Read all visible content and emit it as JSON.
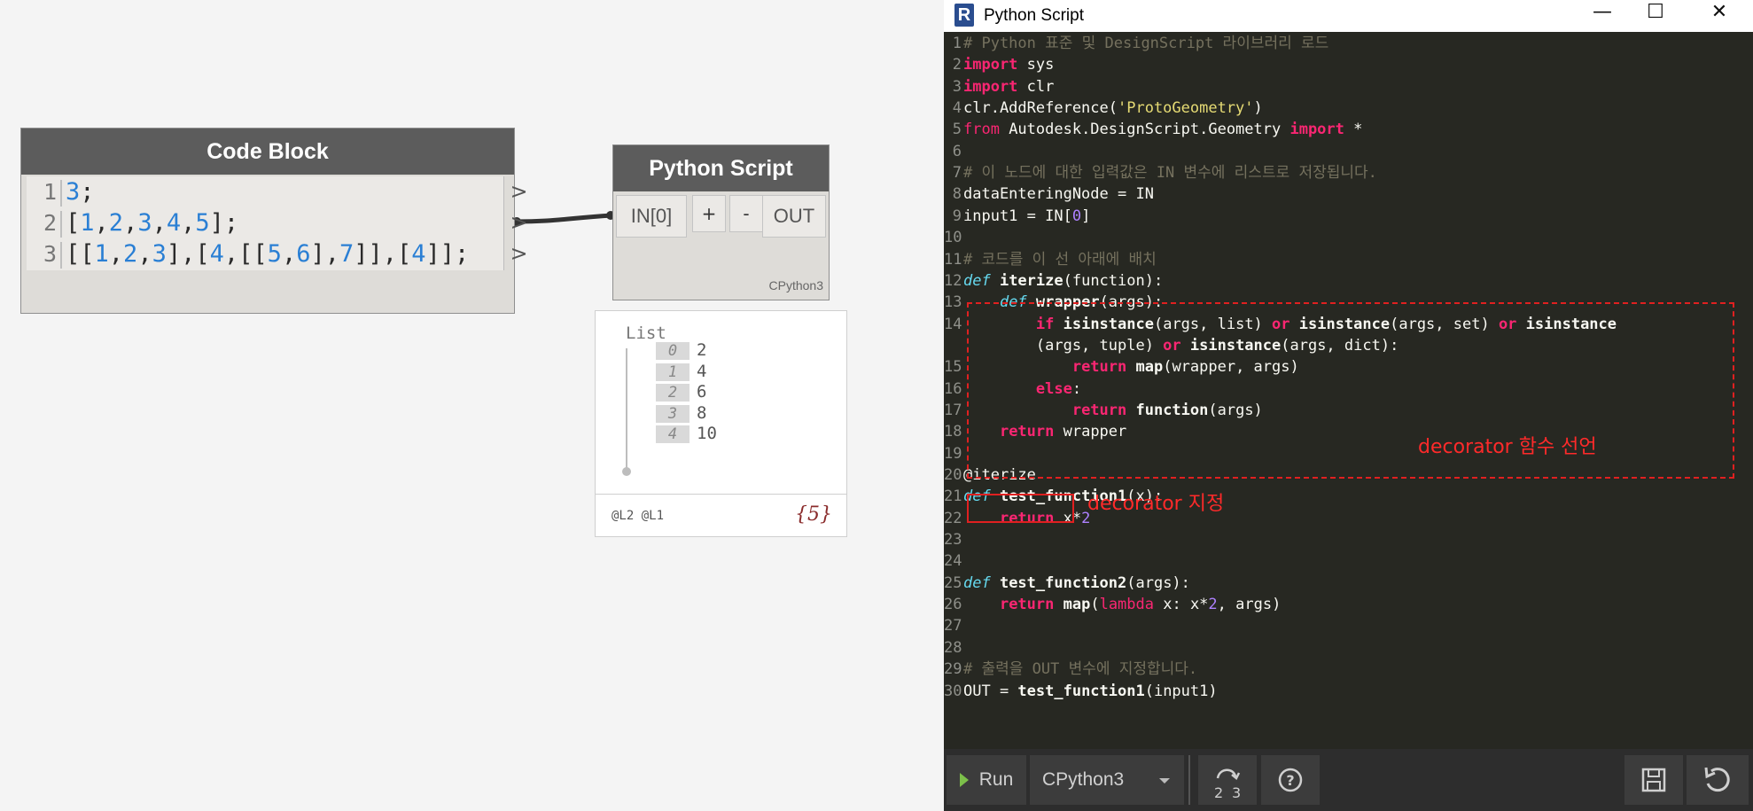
{
  "canvas": {
    "code_block": {
      "title": "Code Block",
      "lines": [
        {
          "num": "1",
          "pre": "",
          "tokens": [
            {
              "t": "3",
              "c": "num"
            },
            {
              "t": ";",
              "c": "text"
            }
          ]
        },
        {
          "num": "2",
          "tokens": [
            {
              "t": "[",
              "c": "text"
            },
            {
              "t": "1",
              "c": "num"
            },
            {
              "t": ",",
              "c": "text"
            },
            {
              "t": "2",
              "c": "num"
            },
            {
              "t": ",",
              "c": "text"
            },
            {
              "t": "3",
              "c": "num"
            },
            {
              "t": ",",
              "c": "text"
            },
            {
              "t": "4",
              "c": "num"
            },
            {
              "t": ",",
              "c": "text"
            },
            {
              "t": "5",
              "c": "num"
            },
            {
              "t": "];",
              "c": "text"
            }
          ]
        },
        {
          "num": "3",
          "tokens": [
            {
              "t": "[[",
              "c": "text"
            },
            {
              "t": "1",
              "c": "num"
            },
            {
              "t": ",",
              "c": "text"
            },
            {
              "t": "2",
              "c": "num"
            },
            {
              "t": ",",
              "c": "text"
            },
            {
              "t": "3",
              "c": "num"
            },
            {
              "t": "],[",
              "c": "text"
            },
            {
              "t": "4",
              "c": "num"
            },
            {
              "t": ",[[",
              "c": "text"
            },
            {
              "t": "5",
              "c": "num"
            },
            {
              "t": ",",
              "c": "text"
            },
            {
              "t": "6",
              "c": "num"
            },
            {
              "t": "],",
              "c": "text"
            },
            {
              "t": "7",
              "c": "num"
            },
            {
              "t": "]],[",
              "c": "text"
            },
            {
              "t": "4",
              "c": "num"
            },
            {
              "t": "]];",
              "c": "text"
            }
          ]
        }
      ],
      "output_ports": [
        ">",
        ">",
        ">"
      ]
    },
    "python_node": {
      "title": "Python Script",
      "input_port": "IN[0]",
      "add_label": "+",
      "remove_label": "-",
      "output_port": "OUT",
      "engine": "CPython3"
    },
    "preview": {
      "title": "List",
      "items": [
        {
          "index": "0",
          "value": "2"
        },
        {
          "index": "1",
          "value": "4"
        },
        {
          "index": "2",
          "value": "6"
        },
        {
          "index": "3",
          "value": "8"
        },
        {
          "index": "4",
          "value": "10"
        }
      ],
      "levels": "@L2 @L1",
      "count": "{5}"
    }
  },
  "editor_window": {
    "app_icon": "R",
    "title": "Python Script",
    "minimize": "—",
    "maximize": "☐",
    "close": "✕",
    "lines": [
      {
        "n": "1",
        "tokens": [
          {
            "t": "# Python 표준 및 DesignScript 라이브러리 로드",
            "c": "cm"
          }
        ]
      },
      {
        "n": "2",
        "tokens": [
          {
            "t": "import",
            "c": "kw bold"
          },
          {
            "t": " sys",
            "c": "txt"
          }
        ]
      },
      {
        "n": "3",
        "tokens": [
          {
            "t": "import",
            "c": "kw bold"
          },
          {
            "t": " clr",
            "c": "txt"
          }
        ]
      },
      {
        "n": "4",
        "tokens": [
          {
            "t": "clr.AddReference(",
            "c": "txt"
          },
          {
            "t": "'ProtoGeometry'",
            "c": "str"
          },
          {
            "t": ")",
            "c": "txt"
          }
        ]
      },
      {
        "n": "5",
        "tokens": [
          {
            "t": "from",
            "c": "kw"
          },
          {
            "t": " Autodesk.DesignScript.Geometry ",
            "c": "txt"
          },
          {
            "t": "import",
            "c": "kw bold"
          },
          {
            "t": " *",
            "c": "txt"
          }
        ]
      },
      {
        "n": "6",
        "tokens": []
      },
      {
        "n": "7",
        "tokens": [
          {
            "t": "# 이 노드에 대한 입력값은 IN 변수에 리스트로 저장됩니다.",
            "c": "cm"
          }
        ]
      },
      {
        "n": "8",
        "tokens": [
          {
            "t": "dataEnteringNode = IN",
            "c": "txt"
          }
        ]
      },
      {
        "n": "9",
        "tokens": [
          {
            "t": "input1 = IN[",
            "c": "txt"
          },
          {
            "t": "0",
            "c": "num"
          },
          {
            "t": "]",
            "c": "txt"
          }
        ]
      },
      {
        "n": "10",
        "tokens": []
      },
      {
        "n": "11",
        "tokens": [
          {
            "t": "# 코드를 이 선 아래에 배치",
            "c": "cm"
          }
        ]
      },
      {
        "n": "12",
        "tokens": [
          {
            "t": "def",
            "c": "df"
          },
          {
            "t": " iterize",
            "c": "txt bold"
          },
          {
            "t": "(function):",
            "c": "txt"
          }
        ]
      },
      {
        "n": "13",
        "tokens": [
          {
            "t": "    ",
            "c": "txt"
          },
          {
            "t": "def",
            "c": "df"
          },
          {
            "t": " wrapper",
            "c": "txt bold"
          },
          {
            "t": "(args):",
            "c": "txt"
          }
        ]
      },
      {
        "n": "14",
        "tokens": [
          {
            "t": "        ",
            "c": "txt"
          },
          {
            "t": "if",
            "c": "kw bold"
          },
          {
            "t": " isinstance",
            "c": "txt bold"
          },
          {
            "t": "(args, list) ",
            "c": "txt"
          },
          {
            "t": "or",
            "c": "kw bold"
          },
          {
            "t": " isinstance",
            "c": "txt bold"
          },
          {
            "t": "(args, set) ",
            "c": "txt"
          },
          {
            "t": "or",
            "c": "kw bold"
          },
          {
            "t": " isinstance",
            "c": "txt bold"
          }
        ]
      },
      {
        "n": "",
        "tokens": [
          {
            "t": "        (args, tuple) ",
            "c": "txt"
          },
          {
            "t": "or",
            "c": "kw bold"
          },
          {
            "t": " isinstance",
            "c": "txt bold"
          },
          {
            "t": "(args, dict):",
            "c": "txt"
          }
        ]
      },
      {
        "n": "15",
        "tokens": [
          {
            "t": "            ",
            "c": "txt"
          },
          {
            "t": "return",
            "c": "kw bold"
          },
          {
            "t": " map",
            "c": "txt bold"
          },
          {
            "t": "(wrapper, args)",
            "c": "txt"
          }
        ]
      },
      {
        "n": "16",
        "tokens": [
          {
            "t": "        ",
            "c": "txt"
          },
          {
            "t": "else",
            "c": "kw bold"
          },
          {
            "t": ":",
            "c": "txt"
          }
        ]
      },
      {
        "n": "17",
        "tokens": [
          {
            "t": "            ",
            "c": "txt"
          },
          {
            "t": "return",
            "c": "kw bold"
          },
          {
            "t": " function",
            "c": "txt bold"
          },
          {
            "t": "(args)",
            "c": "txt"
          }
        ]
      },
      {
        "n": "18",
        "tokens": [
          {
            "t": "    ",
            "c": "txt"
          },
          {
            "t": "return",
            "c": "kw bold"
          },
          {
            "t": " wrapper",
            "c": "txt"
          }
        ]
      },
      {
        "n": "19",
        "tokens": []
      },
      {
        "n": "20",
        "tokens": [
          {
            "t": "@iterize",
            "c": "txt"
          }
        ]
      },
      {
        "n": "21",
        "tokens": [
          {
            "t": "def",
            "c": "df"
          },
          {
            "t": " test_function1",
            "c": "txt bold"
          },
          {
            "t": "(x):",
            "c": "txt"
          }
        ]
      },
      {
        "n": "22",
        "tokens": [
          {
            "t": "    ",
            "c": "txt"
          },
          {
            "t": "return",
            "c": "kw bold"
          },
          {
            "t": " x*",
            "c": "txt"
          },
          {
            "t": "2",
            "c": "num"
          }
        ]
      },
      {
        "n": "23",
        "tokens": []
      },
      {
        "n": "24",
        "tokens": []
      },
      {
        "n": "25",
        "tokens": [
          {
            "t": "def",
            "c": "df"
          },
          {
            "t": " test_function2",
            "c": "txt bold"
          },
          {
            "t": "(args):",
            "c": "txt"
          }
        ]
      },
      {
        "n": "26",
        "tokens": [
          {
            "t": "    ",
            "c": "txt"
          },
          {
            "t": "return",
            "c": "kw bold"
          },
          {
            "t": " map",
            "c": "txt bold"
          },
          {
            "t": "(",
            "c": "txt"
          },
          {
            "t": "lambda",
            "c": "kw"
          },
          {
            "t": " x: x*",
            "c": "txt"
          },
          {
            "t": "2",
            "c": "num"
          },
          {
            "t": ", args)",
            "c": "txt"
          }
        ]
      },
      {
        "n": "27",
        "tokens": []
      },
      {
        "n": "28",
        "tokens": []
      },
      {
        "n": "29",
        "tokens": [
          {
            "t": "# 출력을 OUT 변수에 지정합니다.",
            "c": "cm"
          }
        ]
      },
      {
        "n": "30",
        "tokens": [
          {
            "t": "OUT = ",
            "c": "txt"
          },
          {
            "t": "test_function1",
            "c": "txt bold"
          },
          {
            "t": "(input1)",
            "c": "txt"
          }
        ]
      }
    ],
    "annotations": {
      "decorator_declare": "decorator 함수 선언",
      "decorator_apply": "decorator 지정"
    },
    "toolbar": {
      "run_label": "Run",
      "engine_value": "CPython3",
      "convert_icon": "convert-tabs-icon",
      "help_icon": "help-icon",
      "save_icon": "save-icon",
      "revert_icon": "revert-icon"
    },
    "colors": {
      "editor_bg": "#272822",
      "comment": "#75715e",
      "keyword": "#f92672",
      "def": "#66d9ef",
      "string": "#e6db74",
      "number": "#ae81ff",
      "annotation": "#ff2a2a"
    }
  }
}
